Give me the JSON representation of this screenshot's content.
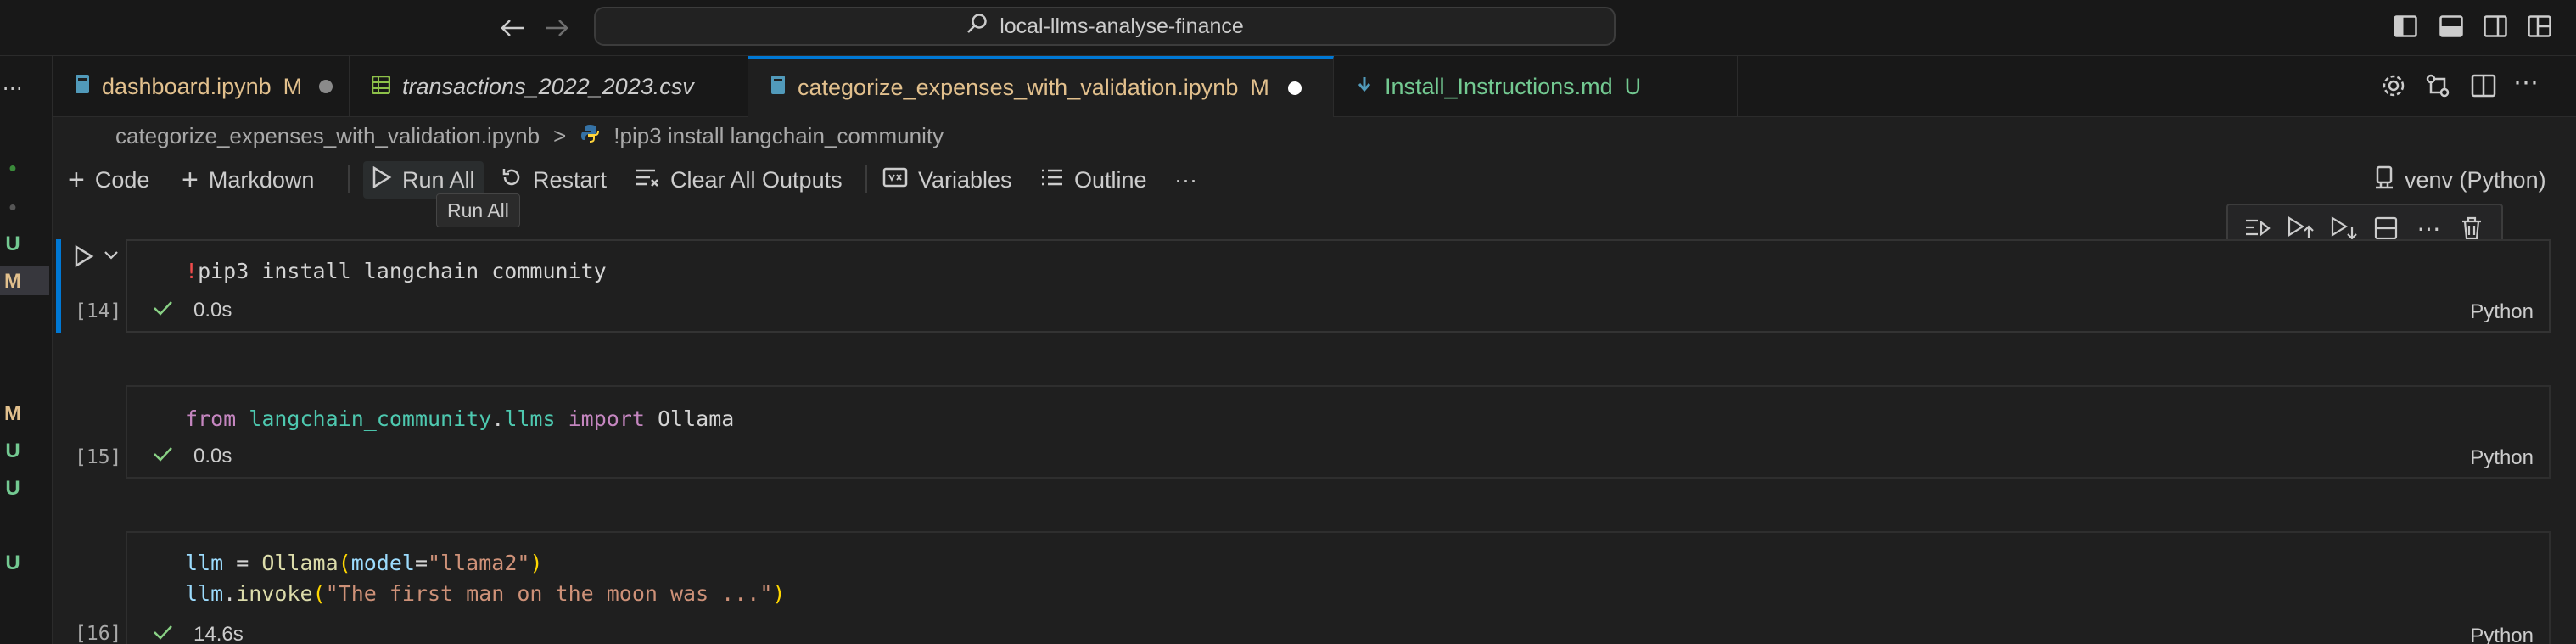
{
  "titlebar": {
    "search_text": "local-llms-analyse-finance"
  },
  "gutter": {
    "marks": [
      {
        "text": "●",
        "color": "#3a8a3a"
      },
      {
        "text": "●",
        "color": "#555555"
      },
      {
        "text": "U",
        "color": "#73c991"
      },
      {
        "text": "M",
        "color": "#e2c08d"
      },
      {
        "text": "M",
        "color": "#e2c08d"
      },
      {
        "text": "U",
        "color": "#73c991"
      },
      {
        "text": "U",
        "color": "#73c991"
      },
      {
        "text": "U",
        "color": "#73c991"
      }
    ]
  },
  "tabs": [
    {
      "label": "dashboard.ipynb",
      "badge": "M",
      "color": "#e2c08d",
      "italic": false
    },
    {
      "label": "transactions_2022_2023.csv",
      "badge": "",
      "color": "#cccccc",
      "italic": true
    },
    {
      "label": "categorize_expenses_with_validation.ipynb",
      "badge": "M",
      "color": "#e2c08d",
      "italic": false
    },
    {
      "label": "Install_Instructions.md",
      "badge": "U",
      "color": "#73c991",
      "italic": false
    }
  ],
  "breadcrumb": {
    "file": "categorize_expenses_with_validation.ipynb",
    "separator": ">",
    "cell": "!pip3 install langchain_community"
  },
  "toolbar": {
    "code": "Code",
    "markdown": "Markdown",
    "run_all": "Run All",
    "restart": "Restart",
    "clear_outputs": "Clear All Outputs",
    "variables": "Variables",
    "outline": "Outline",
    "more": "···",
    "kernel": "venv (Python)",
    "tooltip": "Run All"
  },
  "cells": [
    {
      "count": "[14]",
      "time": "0.0s",
      "lang": "Python"
    },
    {
      "count": "[15]",
      "time": "0.0s",
      "lang": "Python"
    },
    {
      "count": "[16]",
      "time": "14.6s",
      "lang": "Python"
    }
  ],
  "code": {
    "c1_bang": "!",
    "c1_rest": "pip3 install langchain_community",
    "c2_from": "from",
    "c2_mod": "langchain_community",
    "c2_dot": ".",
    "c2_sub": "llms",
    "c2_import": "import",
    "c2_name": "Ollama",
    "c3_l1_var": "llm",
    "c3_l1_eq": " = ",
    "c3_l1_fn": "Ollama",
    "c3_l1_p1": "(",
    "c3_l1_kw": "model",
    "c3_l1_eq2": "=",
    "c3_l1_str": "\"llama2\"",
    "c3_l1_p2": ")",
    "c3_l2_var": "llm",
    "c3_l2_dot": ".",
    "c3_l2_fn": "invoke",
    "c3_l2_p1": "(",
    "c3_l2_str": "\"The first man on the moon was ...\"",
    "c3_l2_p2": ")"
  }
}
